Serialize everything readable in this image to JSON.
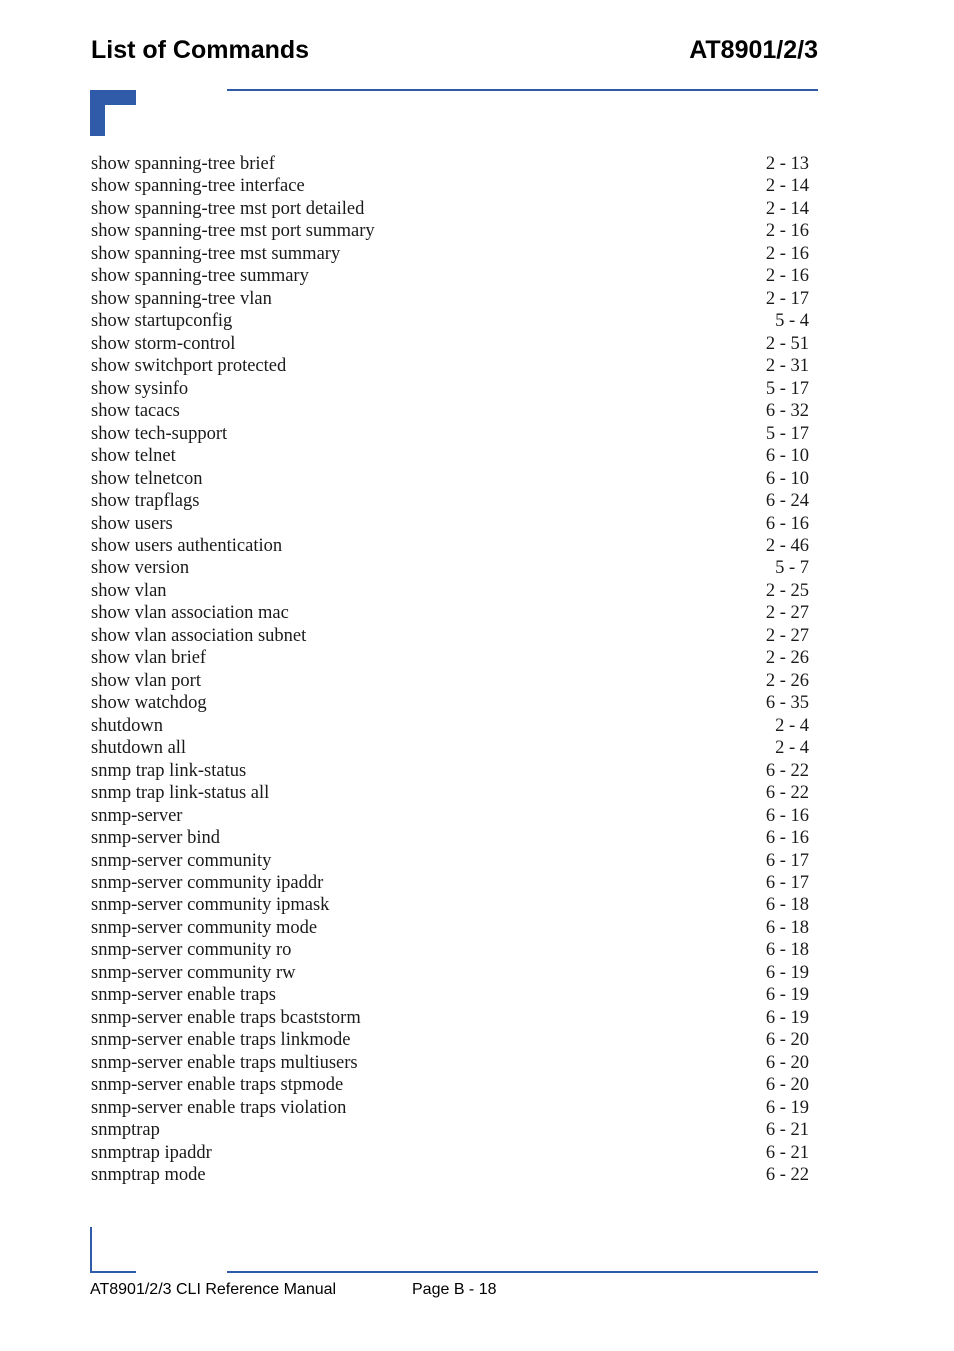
{
  "header": {
    "title": "List of Commands",
    "model": "AT8901/2/3"
  },
  "accent_color": "#2f5ba8",
  "entries": [
    {
      "command": "show spanning-tree brief",
      "page": "2 - 13"
    },
    {
      "command": "show spanning-tree interface",
      "page": "2 - 14"
    },
    {
      "command": "show spanning-tree mst port detailed",
      "page": "2 - 14"
    },
    {
      "command": "show spanning-tree mst port summary",
      "page": "2 - 16"
    },
    {
      "command": "show spanning-tree mst summary",
      "page": "2 - 16"
    },
    {
      "command": "show spanning-tree summary",
      "page": "2 - 16"
    },
    {
      "command": "show spanning-tree vlan",
      "page": "2 - 17"
    },
    {
      "command": "show startupconfig",
      "page": "5 - 4"
    },
    {
      "command": "show storm-control",
      "page": "2 - 51"
    },
    {
      "command": "show switchport protected",
      "page": "2 - 31"
    },
    {
      "command": "show sysinfo",
      "page": "5 - 17"
    },
    {
      "command": "show tacacs",
      "page": "6 - 32"
    },
    {
      "command": "show tech-support",
      "page": "5 - 17"
    },
    {
      "command": "show telnet",
      "page": "6 - 10"
    },
    {
      "command": "show telnetcon",
      "page": "6 - 10"
    },
    {
      "command": "show trapflags",
      "page": "6 - 24"
    },
    {
      "command": "show users",
      "page": "6 - 16"
    },
    {
      "command": "show users authentication",
      "page": "2 - 46"
    },
    {
      "command": "show version",
      "page": "5 - 7"
    },
    {
      "command": "show vlan",
      "page": "2 - 25"
    },
    {
      "command": "show vlan association mac",
      "page": "2 - 27"
    },
    {
      "command": "show vlan association subnet",
      "page": "2 - 27"
    },
    {
      "command": "show vlan brief",
      "page": "2 - 26"
    },
    {
      "command": "show vlan port",
      "page": "2 - 26"
    },
    {
      "command": "show watchdog",
      "page": "6 - 35"
    },
    {
      "command": "shutdown",
      "page": "2 - 4"
    },
    {
      "command": "shutdown all",
      "page": "2 - 4"
    },
    {
      "command": "snmp trap link-status",
      "page": "6 - 22"
    },
    {
      "command": "snmp trap link-status all",
      "page": "6 - 22"
    },
    {
      "command": "snmp-server",
      "page": "6 - 16"
    },
    {
      "command": "snmp-server bind",
      "page": "6 - 16"
    },
    {
      "command": "snmp-server community",
      "page": "6 - 17"
    },
    {
      "command": "snmp-server community ipaddr",
      "page": "6 - 17"
    },
    {
      "command": "snmp-server community ipmask",
      "page": "6 - 18"
    },
    {
      "command": "snmp-server community mode",
      "page": "6 - 18"
    },
    {
      "command": "snmp-server community ro",
      "page": "6 - 18"
    },
    {
      "command": "snmp-server community rw",
      "page": "6 - 19"
    },
    {
      "command": "snmp-server enable traps",
      "page": "6 - 19"
    },
    {
      "command": "snmp-server enable traps bcaststorm",
      "page": "6 - 19"
    },
    {
      "command": "snmp-server enable traps linkmode",
      "page": "6 - 20"
    },
    {
      "command": "snmp-server enable traps multiusers",
      "page": "6 - 20"
    },
    {
      "command": "snmp-server enable traps stpmode",
      "page": "6 - 20"
    },
    {
      "command": "snmp-server enable traps violation",
      "page": "6 - 19"
    },
    {
      "command": "snmptrap",
      "page": "6 - 21"
    },
    {
      "command": "snmptrap ipaddr",
      "page": "6 - 21"
    },
    {
      "command": "snmptrap mode",
      "page": "6 - 22"
    }
  ],
  "footer": {
    "manual": "AT8901/2/3 CLI Reference Manual",
    "page": "Page B - 18"
  }
}
